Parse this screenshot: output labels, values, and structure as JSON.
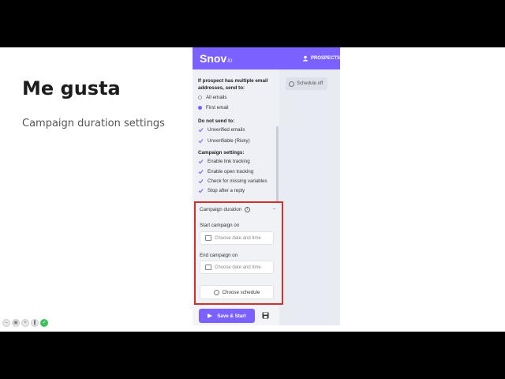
{
  "slide": {
    "title": "Me gusta",
    "subtitle": "Campaign duration settings"
  },
  "app": {
    "logo": "Snov",
    "logo_suffix": "io",
    "nav_label": "PROSPECTS",
    "accent": "#7b61ff",
    "schedule_status": "Schedule off",
    "multiple_email_heading": "If prospect has multiple email addresses, send to:",
    "send_options": [
      {
        "label": "All emails",
        "selected": false
      },
      {
        "label": "First email",
        "selected": true
      }
    ],
    "do_not_send_heading": "Do not send to:",
    "do_not_send": [
      {
        "label": "Unverified emails",
        "checked": true
      },
      {
        "label": "Unverifiable (Risky)",
        "checked": true
      }
    ],
    "campaign_settings_heading": "Campaign settings:",
    "campaign_settings": [
      {
        "label": "Enable link tracking",
        "checked": true
      },
      {
        "label": "Enable open tracking",
        "checked": true
      },
      {
        "label": "Check for missing variables",
        "checked": true
      },
      {
        "label": "Stop after a reply",
        "checked": true
      }
    ],
    "duration": {
      "heading": "Campaign duration",
      "start_label": "Start campaign on",
      "start_placeholder": "Choose date and time",
      "end_label": "End campaign on",
      "end_placeholder": "Choose date and time",
      "schedule_button": "Choose schedule",
      "highlight_color": "#d32f2f"
    },
    "save_start_button": "Save & Start"
  }
}
